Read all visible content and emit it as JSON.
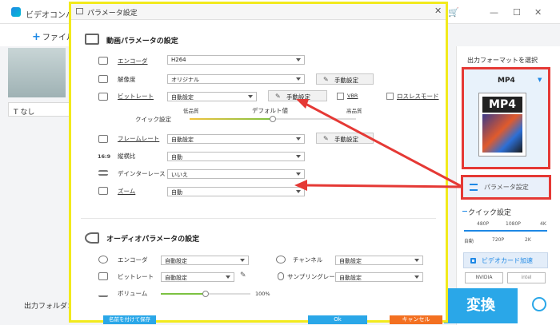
{
  "app": {
    "title": "ビデオコンバーター",
    "add_file": "ファイル",
    "subtitle_none": "なし",
    "output_folder": "出力フォルダ："
  },
  "right_panel": {
    "title": "出力フォーマットを選択",
    "format_name": "MP4",
    "format_icon_label": "MP4",
    "param_button": "パラメータ設定",
    "quick_setting": "クイック設定",
    "ticks_top": [
      "480P",
      "1080P",
      "4K"
    ],
    "ticks_bottom": [
      "自動",
      "720P",
      "2K"
    ],
    "gpu_button": "ビデオカード加速",
    "nvidia": "NVIDIA",
    "intel": "intel",
    "convert_button": "変換"
  },
  "dialog": {
    "title": "パラメータ設定",
    "video_section": "動画パラメータの設定",
    "video": {
      "encoder_label": "エンコーダ",
      "encoder_value": "H264",
      "resolution_label": "解像度",
      "resolution_value": "オリジナル",
      "manual_1": "手動設定",
      "bitrate_label": "ビットレート",
      "bitrate_value": "自動設定",
      "manual_2": "手動設定",
      "vbr_label": "VBR",
      "lossless_label": "ロスレスモード",
      "quick_label": "クイック設定",
      "low_quality": "低品質",
      "default_value": "デフォルト値",
      "high_quality": "高品質",
      "quality_level": 0.5,
      "framerate_label": "フレームレート",
      "framerate_value": "自動設定",
      "manual_3": "手動設定",
      "aspect_label": "縦横比",
      "aspect_value": "自動",
      "deinterlace_label": "デインターレース",
      "deinterlace_value": "いいえ",
      "zoom_label": "ズーム",
      "zoom_value": "自動"
    },
    "audio_section": "オーディオパラメータの設定",
    "audio": {
      "encoder_label": "エンコーダ",
      "encoder_value": "自動設定",
      "channel_label": "チャンネル",
      "channel_value": "自動設定",
      "bitrate_label": "ビットレート",
      "bitrate_value": "自動設定",
      "samplerate_label": "サンプリングレート",
      "samplerate_value": "自動設定",
      "volume_label": "ボリューム",
      "volume_value": "100%",
      "volume_level": 0.5
    },
    "save_as": "名前を付けて保存",
    "ok": "Ok",
    "cancel": "キャンセル"
  },
  "colors": {
    "accent": "#2aa7e8",
    "highlight_red": "#e53935",
    "dialog_border": "#f2ea1c",
    "cancel": "#f37021"
  }
}
